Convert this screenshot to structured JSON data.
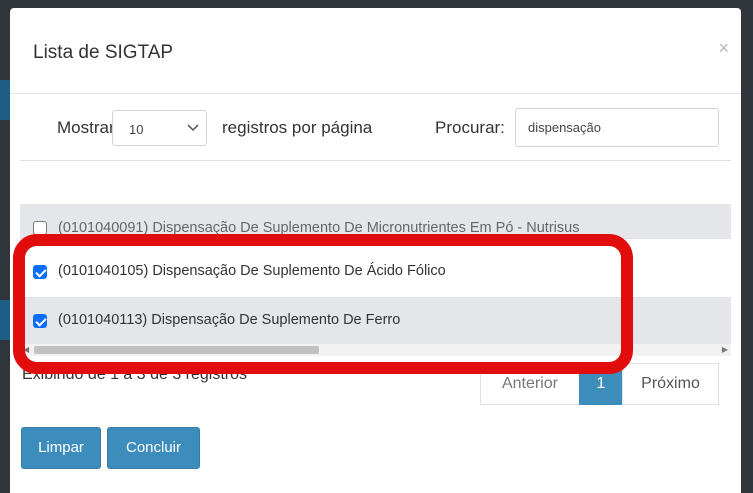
{
  "modal": {
    "title": "Lista de SIGTAP",
    "close_glyph": "×"
  },
  "controls": {
    "show_label": "Mostrar",
    "page_size": "10",
    "records_label": "registros por página",
    "search_label": "Procurar:",
    "search_value": "dispensação"
  },
  "rows": [
    {
      "label": "(0101040091) Dispensação De Suplemento De Micronutrientes Em Pó - Nutrisus",
      "checked": false
    },
    {
      "label": "(0101040105) Dispensação De Suplemento De Ácido Fólico",
      "checked": true
    },
    {
      "label": "(0101040113) Dispensação De Suplemento De Ferro",
      "checked": true
    }
  ],
  "footer": {
    "info": "Exibindo de 1 a 3 de 3 registros",
    "prev": "Anterior",
    "current_page": "1",
    "next": "Próximo"
  },
  "buttons": {
    "clear": "Limpar",
    "done": "Concluir"
  },
  "colors": {
    "primary": "#3c8dbc",
    "highlight": "#e10d0d",
    "checkbox": "#0d6efd"
  }
}
